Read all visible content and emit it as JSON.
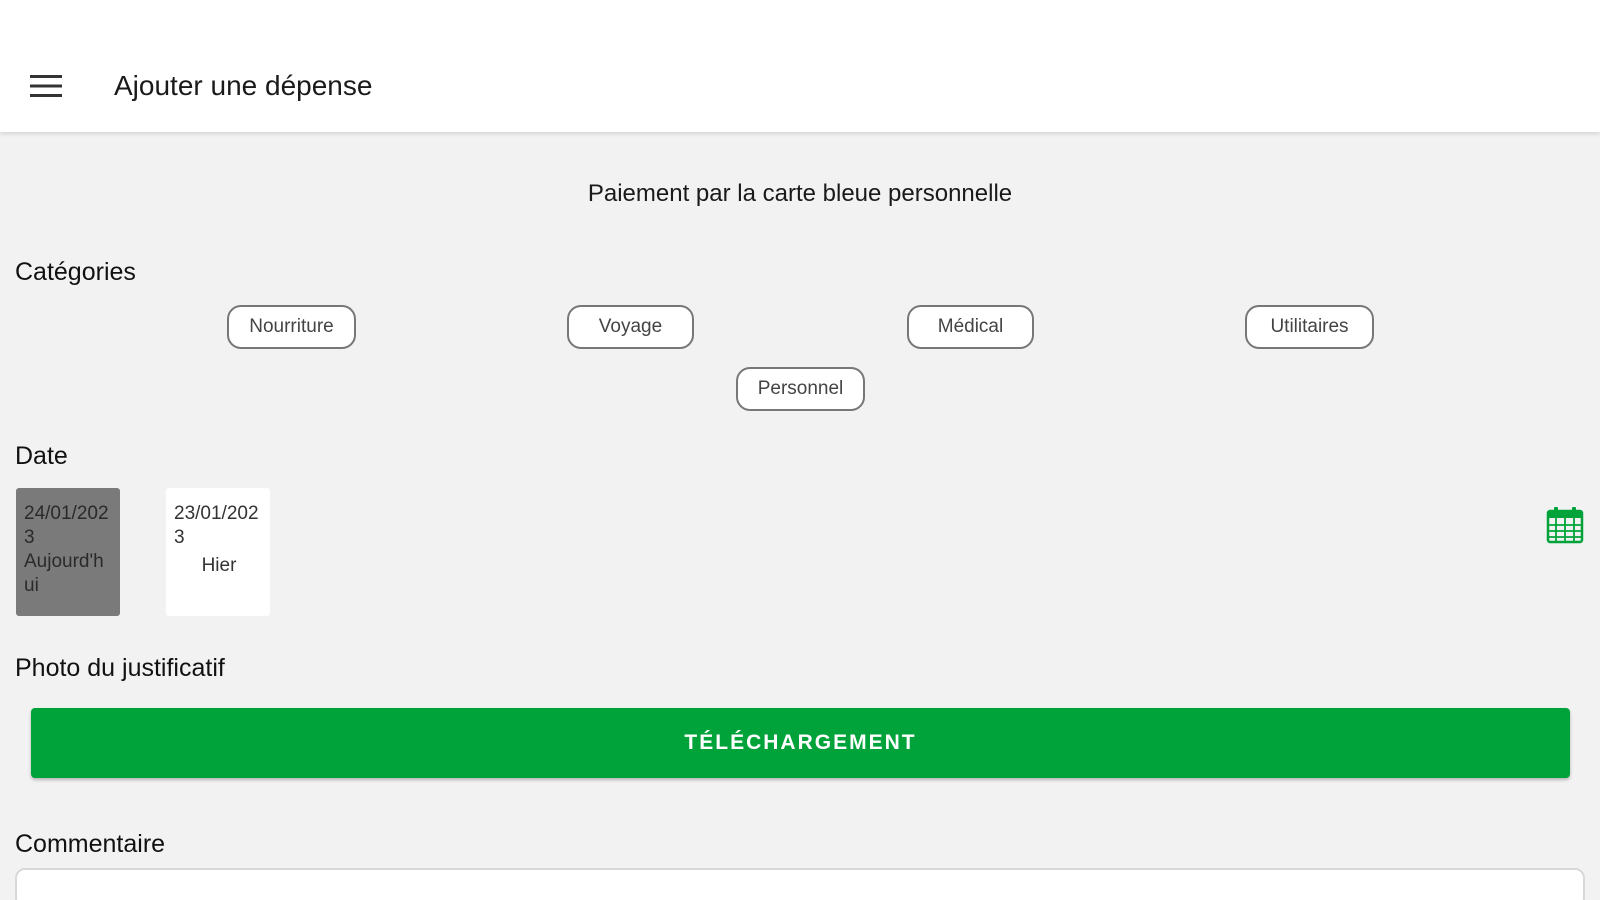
{
  "appbar": {
    "menu_icon": "hamburger-menu-icon",
    "title": "Ajouter une dépense"
  },
  "subtitle": "Paiement par la carte bleue personnelle",
  "categories": {
    "label": "Catégories",
    "items": [
      {
        "label": "Nourriture"
      },
      {
        "label": "Voyage"
      },
      {
        "label": "Médical"
      },
      {
        "label": "Utilitaires"
      },
      {
        "label": "Personnel"
      }
    ]
  },
  "date": {
    "label": "Date",
    "options": [
      {
        "date": "24/01/2023",
        "relative": "Aujourd'hui",
        "selected": true
      },
      {
        "date": "23/01/2023",
        "relative": "Hier",
        "selected": false
      }
    ],
    "calendar_icon": "calendar-icon"
  },
  "receipt": {
    "label": "Photo du justificatif",
    "upload_label": "TÉLÉCHARGEMENT"
  },
  "comment": {
    "label": "Commentaire",
    "value": ""
  },
  "colors": {
    "accent": "#00a33a",
    "background": "#f2f2f2",
    "selected_card": "#7a7a7a"
  }
}
